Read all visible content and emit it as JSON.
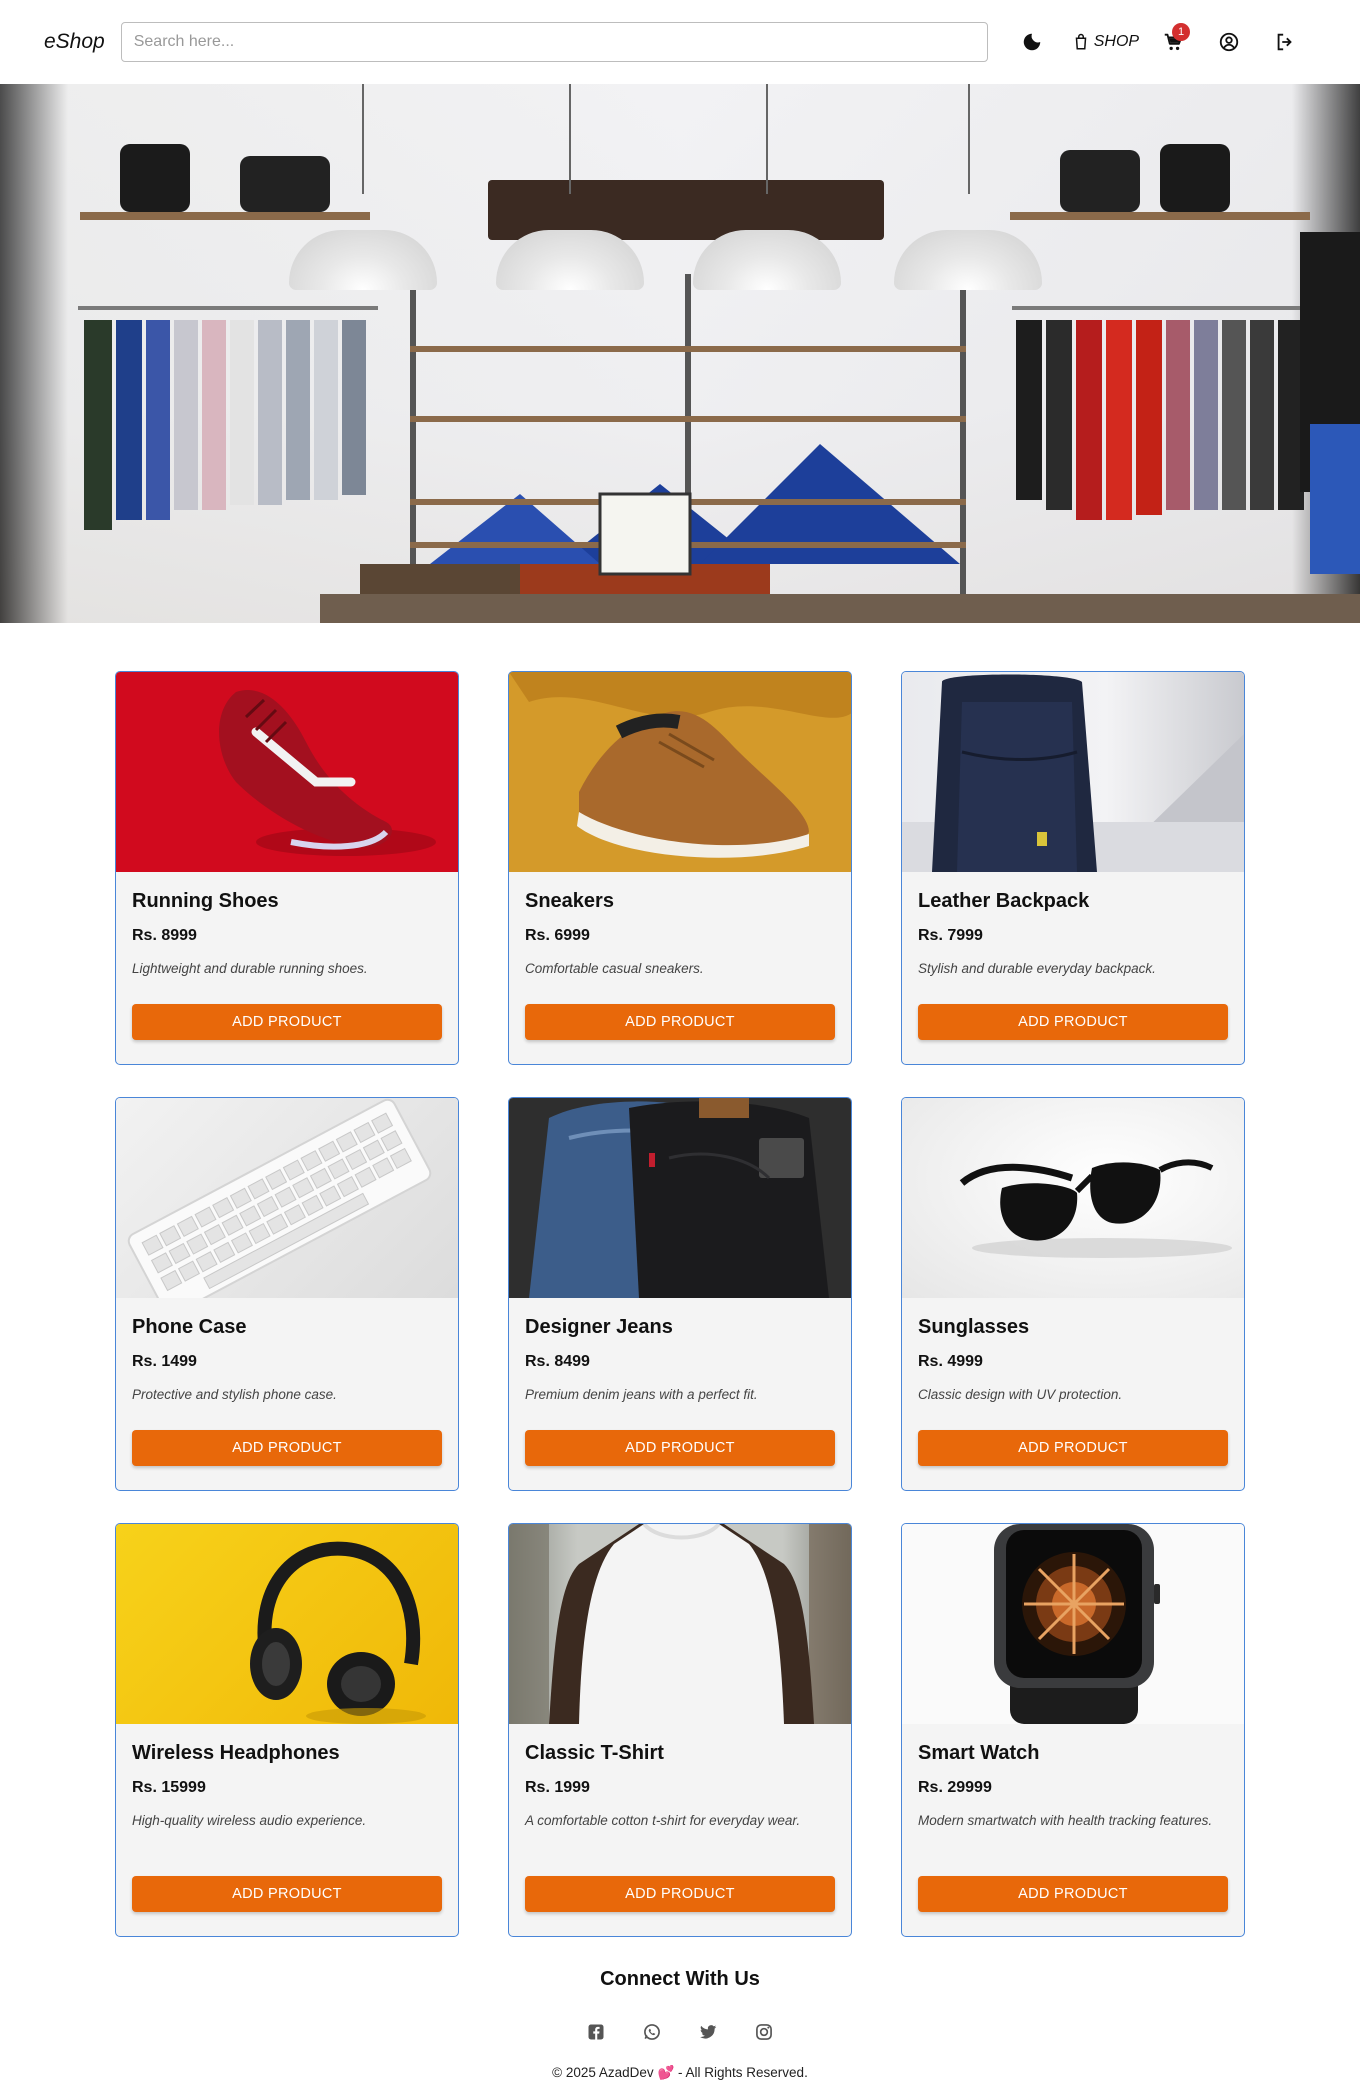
{
  "header": {
    "logo": "eShop",
    "search_placeholder": "Search here...",
    "shop_label": "SHOP",
    "cart_count": "1",
    "icons": [
      "moon-icon",
      "shopping-bag-icon",
      "cart-icon",
      "account-circle-icon",
      "logout-icon"
    ]
  },
  "products": [
    {
      "name": "Running Shoes",
      "price": "Rs. 8999",
      "description": "Lightweight and durable running shoes.",
      "button": "ADD PRODUCT"
    },
    {
      "name": "Sneakers",
      "price": "Rs. 6999",
      "description": "Comfortable casual sneakers.",
      "button": "ADD PRODUCT"
    },
    {
      "name": "Leather Backpack",
      "price": "Rs. 7999",
      "description": "Stylish and durable everyday backpack.",
      "button": "ADD PRODUCT"
    },
    {
      "name": "Phone Case",
      "price": "Rs. 1499",
      "description": "Protective and stylish phone case.",
      "button": "ADD PRODUCT"
    },
    {
      "name": "Designer Jeans",
      "price": "Rs. 8499",
      "description": "Premium denim jeans with a perfect fit.",
      "button": "ADD PRODUCT"
    },
    {
      "name": "Sunglasses",
      "price": "Rs. 4999",
      "description": "Classic design with UV protection.",
      "button": "ADD PRODUCT"
    },
    {
      "name": "Wireless Headphones",
      "price": "Rs. 15999",
      "description": "High-quality wireless audio experience.",
      "button": "ADD PRODUCT"
    },
    {
      "name": "Classic T-Shirt",
      "price": "Rs. 1999",
      "description": "A comfortable cotton t-shirt for everyday wear.",
      "button": "ADD PRODUCT"
    },
    {
      "name": "Smart Watch",
      "price": "Rs. 29999",
      "description": "Modern smartwatch with health tracking features.",
      "button": "ADD PRODUCT"
    }
  ],
  "footer": {
    "title": "Connect With Us",
    "socials": [
      "facebook-icon",
      "whatsapp-icon",
      "twitter-icon",
      "instagram-icon"
    ],
    "copyright_prefix": "© 2025 AzadDev",
    "copyright_heart": "💕",
    "copyright_suffix": " - All Rights Reserved."
  },
  "colors": {
    "accent_button": "#e8680a",
    "card_border": "#4a86d8",
    "badge": "#d32f2f"
  }
}
